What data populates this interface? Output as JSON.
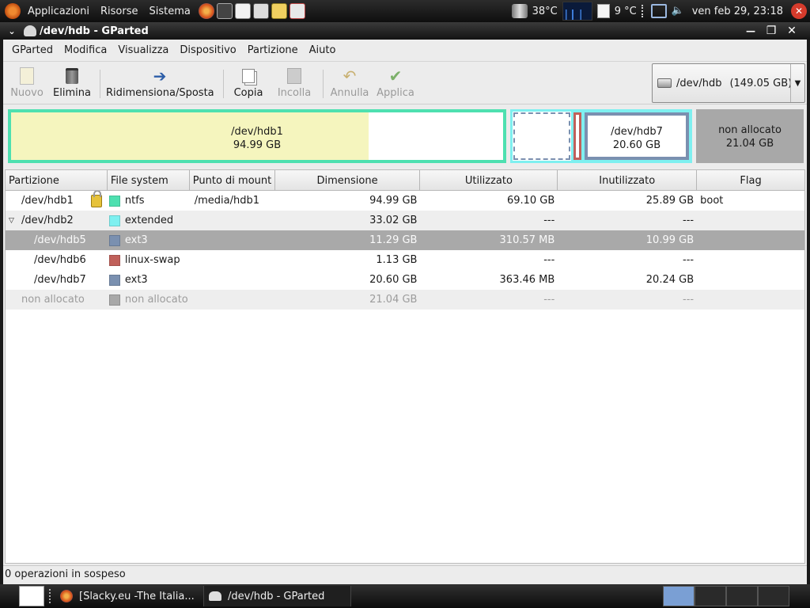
{
  "top_panel": {
    "menus": [
      "Applicazioni",
      "Risorse",
      "Sistema"
    ],
    "cpu_temp": "38°C",
    "weather": "9 °C",
    "datetime": "ven feb 29, 23:18"
  },
  "window": {
    "title": "/dev/hdb - GParted",
    "buttons": {
      "minimize": "—",
      "maximize": "❐",
      "close": "✕"
    }
  },
  "menubar": [
    "GParted",
    "Modifica",
    "Visualizza",
    "Dispositivo",
    "Partizione",
    "Aiuto"
  ],
  "toolbar": {
    "nuovo": "Nuovo",
    "elimina": "Elimina",
    "ridimensiona": "Ridimensiona/Sposta",
    "copia": "Copia",
    "incolla": "Incolla",
    "annulla": "Annulla",
    "applica": "Applica",
    "device_name": "/dev/hdb",
    "device_size": "(149.05 GB)"
  },
  "diskmap": {
    "hdb1_name": "/dev/hdb1",
    "hdb1_size": "94.99 GB",
    "hdb7_name": "/dev/hdb7",
    "hdb7_size": "20.60 GB",
    "unalloc_name": "non allocato",
    "unalloc_size": "21.04 GB",
    "hdb1_used_fraction": 0.727,
    "colors": {
      "ntfs": "#4ee0b0",
      "extended": "#7ef0f0",
      "ext3": "#7a90b0",
      "swap": "#c0605a",
      "ntfs_used": "#f5f5be",
      "unalloc": "#a8a8a8"
    }
  },
  "table": {
    "headers": [
      "Partizione",
      "File system",
      "Punto di mount",
      "Dimensione",
      "Utilizzato",
      "Inutilizzato",
      "Flag"
    ],
    "rows": [
      {
        "partition": "/dev/hdb1",
        "fs": "ntfs",
        "color": "#4ee0b0",
        "mount": "/media/hdb1",
        "size": "94.99 GB",
        "used": "69.10 GB",
        "unused": "25.89 GB",
        "flag": "boot"
      },
      {
        "partition": "/dev/hdb2",
        "fs": "extended",
        "color": "#7ef0f0",
        "mount": "",
        "size": "33.02 GB",
        "used": "---",
        "unused": "---",
        "flag": ""
      },
      {
        "partition": "/dev/hdb5",
        "fs": "ext3",
        "color": "#7a90b0",
        "mount": "",
        "size": "11.29 GB",
        "used": "310.57 MB",
        "unused": "10.99 GB",
        "flag": ""
      },
      {
        "partition": "/dev/hdb6",
        "fs": "linux-swap",
        "color": "#c0605a",
        "mount": "",
        "size": "1.13 GB",
        "used": "---",
        "unused": "---",
        "flag": ""
      },
      {
        "partition": "/dev/hdb7",
        "fs": "ext3",
        "color": "#7a90b0",
        "mount": "",
        "size": "20.60 GB",
        "used": "363.46 MB",
        "unused": "20.24 GB",
        "flag": ""
      },
      {
        "partition": "non allocato",
        "fs": "non allocato",
        "color": "#a8a8a8",
        "mount": "",
        "size": "21.04 GB",
        "used": "---",
        "unused": "---",
        "flag": ""
      }
    ]
  },
  "status": "0 operazioni in sospeso",
  "taskbar": {
    "task1": "[Slacky.eu -The Italia...",
    "task2": "/dev/hdb - GParted"
  }
}
